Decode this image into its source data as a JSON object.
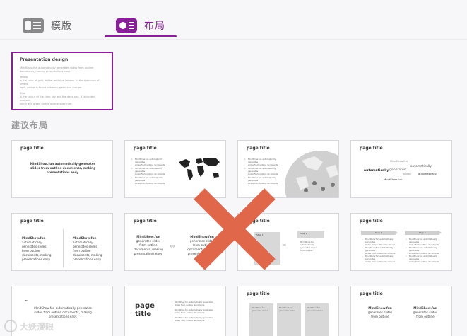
{
  "tabs": {
    "template": {
      "label": "模版",
      "icon": "template-icon"
    },
    "layout": {
      "label": "布局",
      "icon": "layout-icon",
      "active": true
    }
  },
  "current_slide": {
    "title": "Presentation design",
    "lines1": [
      "MindShow.fun automatically generates slides from outline",
      "documents, making presentations easy."
    ],
    "lines2": [
      "Yellow",
      "is the color of gold, butter and ripe lemons. In the spectrum of visible",
      "light, yellow is found between green and orange."
    ],
    "lines3": [
      "Blue",
      "is the colour of the clear sky and the deep sea. It is located between",
      "violet and green on the optical spectrum."
    ]
  },
  "section_title": "建议布局",
  "layouts": {
    "page_title": "page title",
    "desc1": "MindShow.fun automatically generates",
    "desc2": "slides from outline documents, making",
    "desc3": "presentations easy.",
    "short1": "MindShow.fun",
    "short2": "automatically",
    "short3": "generates slides",
    "short4": "from outline",
    "short5": "documents, making",
    "short6": "presentations easy.",
    "list_item": "MindShow.fun automatically generates",
    "list_item2": "slides from outline documents",
    "cloud1": "MindShow.fun",
    "cloud2": "automatically",
    "cloud3": "generates",
    "cloud4": "slides",
    "cloud5": "MindShow.fun",
    "cloud6": "automatically",
    "step1": "Step 1",
    "step2": "Step 2",
    "big_title1": "page",
    "big_title2": "title"
  },
  "colors": {
    "accent": "#8a1f9a",
    "overlay_x": "#e0674a"
  },
  "watermark": "大妖漫眼"
}
